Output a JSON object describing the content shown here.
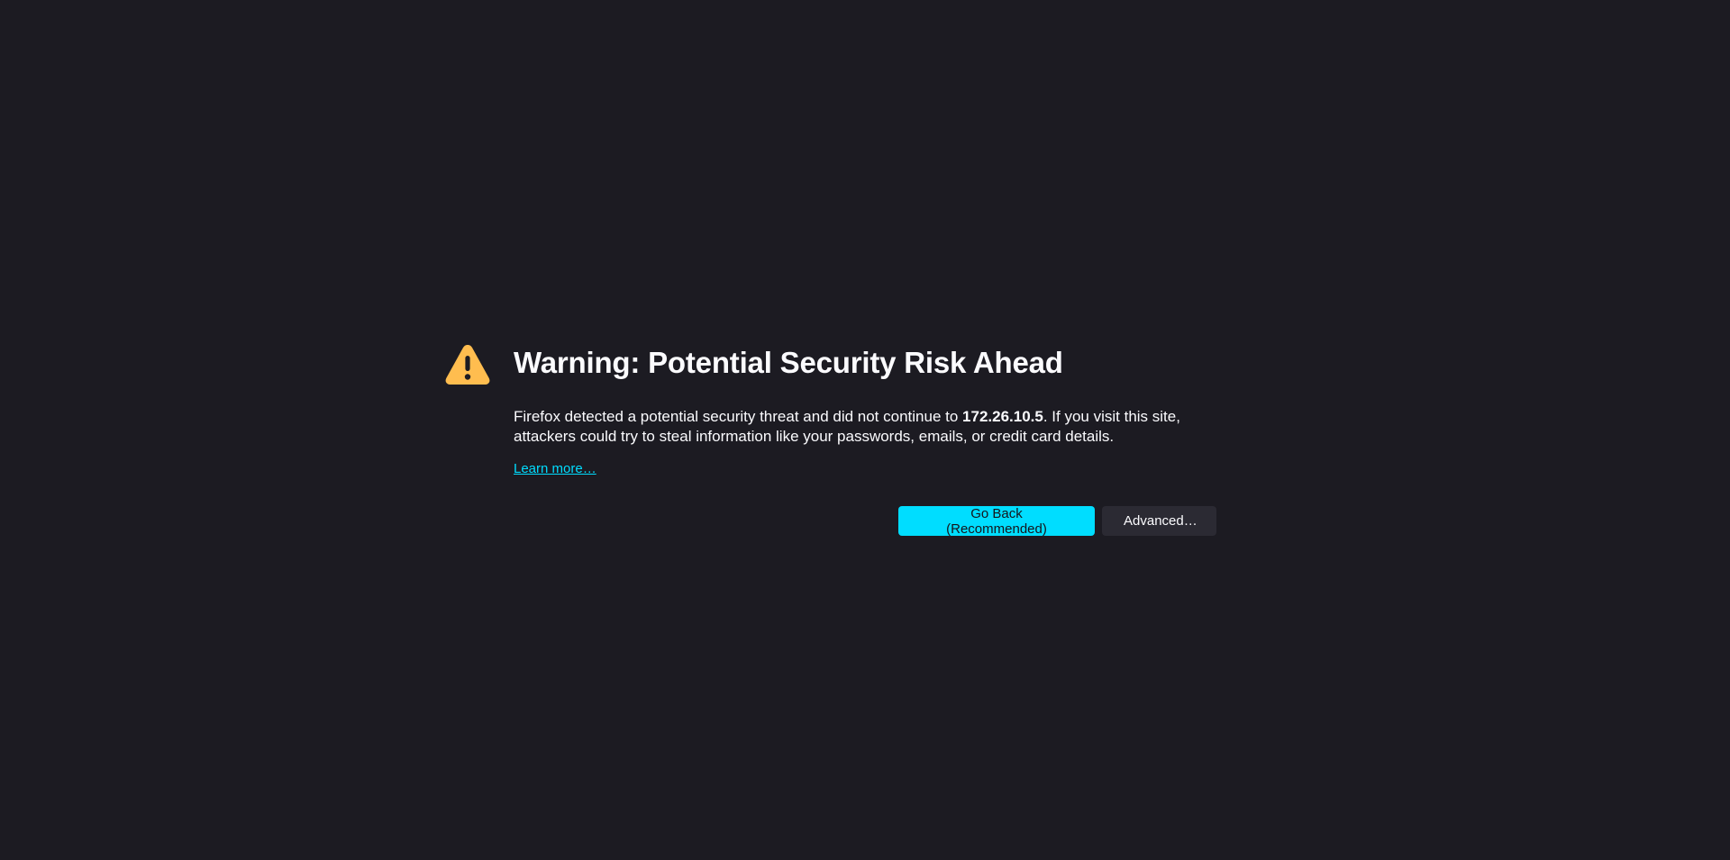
{
  "page": {
    "title": "Warning: Potential Security Risk Ahead",
    "description_prefix": "Firefox detected a potential security threat and did not continue to ",
    "host": "172.26.10.5",
    "description_suffix": ". If you visit this site, attackers could try to steal information like your passwords, emails, or credit card details.",
    "learn_more": "Learn more…",
    "icon": "warning-triangle-icon"
  },
  "buttons": {
    "go_back": "Go Back (Recommended)",
    "advanced": "Advanced…"
  },
  "colors": {
    "background": "#1c1b22",
    "text": "#fbfbfe",
    "accent": "#00ddff",
    "warning": "#ffbd4f",
    "secondary_button": "#2b2a33"
  }
}
